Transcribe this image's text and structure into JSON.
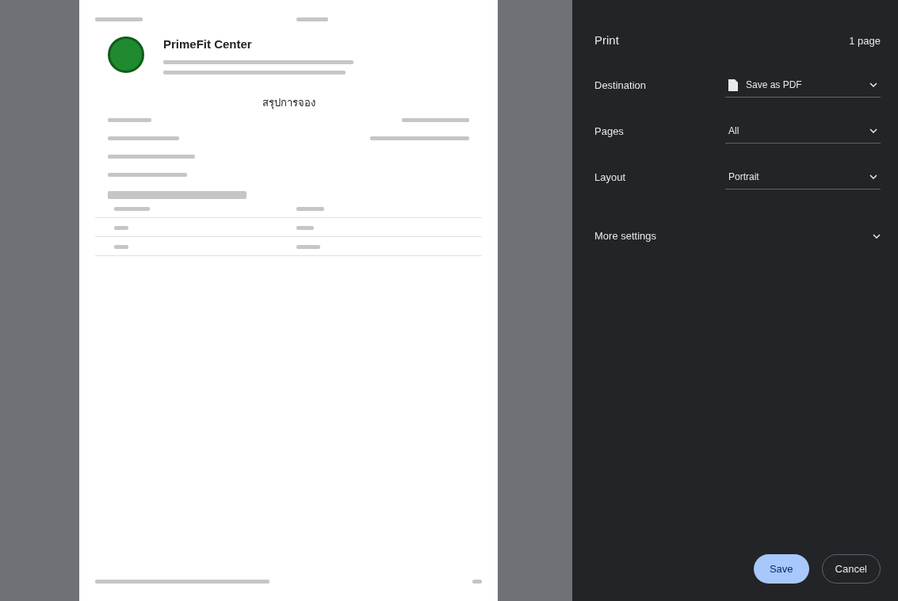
{
  "preview": {
    "company": "PrimeFit Center",
    "summary_title": "สรุปการจอง"
  },
  "dialog": {
    "title": "Print",
    "page_count": "1 page",
    "settings": [
      {
        "kind": "destination",
        "label": "Destination",
        "value": "Save as PDF"
      },
      {
        "kind": "select",
        "label": "Pages",
        "value": "All"
      },
      {
        "kind": "select",
        "label": "Layout",
        "value": "Portrait"
      }
    ],
    "more_settings": {
      "label": "More settings",
      "expanded": false
    },
    "buttons": [
      {
        "kind": "primary",
        "label": "Save"
      },
      {
        "kind": "secondary",
        "label": "Cancel"
      }
    ]
  }
}
